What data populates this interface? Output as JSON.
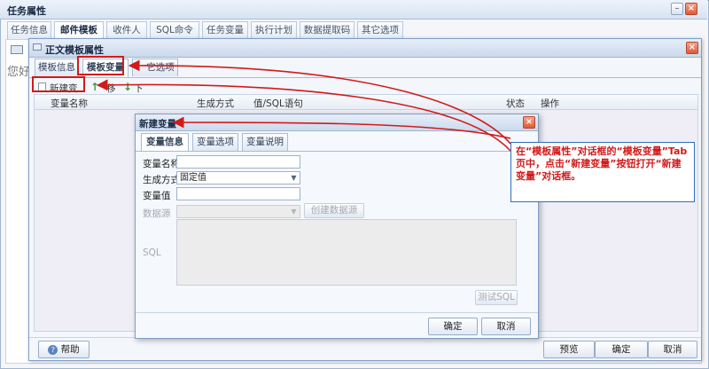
{
  "outer": {
    "title": "任务属性",
    "tabs": [
      "任务信息",
      "邮件模板",
      "收件人",
      "SQL命令",
      "任务变量",
      "执行计划",
      "数据提取码",
      "其它选项"
    ],
    "active_tab": 1,
    "greeting": "您好"
  },
  "template_dialog": {
    "title": "正文模板属性",
    "tabs": [
      "模板信息",
      "模板变量",
      "其它选项"
    ],
    "tab3_visible": "它选项",
    "active_tab": 1,
    "toolbar": {
      "new_var": "新建变量",
      "up_partial": "移",
      "down": "下移"
    },
    "grid_columns": [
      "变量名称",
      "生成方式",
      "值/SQL语句",
      "状态",
      "操作"
    ],
    "footer": {
      "help": "帮助",
      "preview": "预览",
      "ok": "确定",
      "cancel": "取消"
    }
  },
  "new_var_dialog": {
    "title": "新建变量",
    "tabs": [
      "变量信息",
      "变量选项",
      "变量说明"
    ],
    "active_tab": 0,
    "labels": {
      "name": "变量名称",
      "gen_method": "生成方式",
      "value": "变量值",
      "datasource": "数据源",
      "sql": "SQL"
    },
    "gen_method_value": "固定值",
    "create_datasource": "创建数据源",
    "test_sql": "测试SQL",
    "ok": "确定",
    "cancel": "取消"
  },
  "annotation": {
    "text": "在“模板属性”对话框的“模板变量”Tab页中，点击“新建变量”按钮打开“新建变量”对话框。"
  },
  "colors": {
    "annotation_red": "#d21a1a",
    "title_bar": "#cbdaed"
  }
}
